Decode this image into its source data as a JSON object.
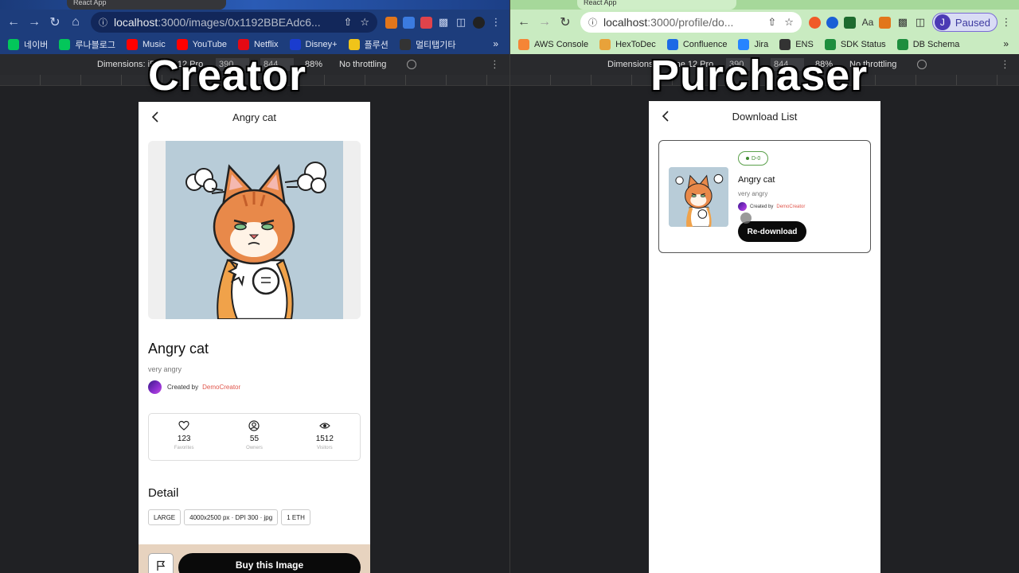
{
  "left": {
    "overlay_label": "Creator",
    "browser": {
      "tab_title": "React App",
      "url_host": "localhost",
      "url_path": ":3000/images/0x1192BBEAdc6...",
      "bookmarks": [
        "네이버",
        "루나블로그",
        "Music",
        "YouTube",
        "Netflix",
        "Disney+",
        "플루션",
        "멀티탭기타"
      ],
      "bookmark_colors": [
        "#03c75a",
        "#03c75a",
        "#ff0000",
        "#ff0000",
        "#e50914",
        "#1a3ccf",
        "#f0c419",
        "#333333"
      ]
    },
    "devtools": {
      "dimensions_label": "Dimensions: iPhone 12 Pro",
      "width": "390",
      "height": "844",
      "zoom": "88%",
      "throttling": "No throttling"
    },
    "page": {
      "header_title": "Angry cat",
      "image_title": "Angry cat",
      "image_desc": "very angry",
      "created_by_label": "Created by",
      "creator_name": "DemoCreator",
      "stats": [
        {
          "icon": "heart-icon",
          "value": "123",
          "label": "Favorites"
        },
        {
          "icon": "user-circle-icon",
          "value": "55",
          "label": "Owners"
        },
        {
          "icon": "eye-icon",
          "value": "1512",
          "label": "Visitors"
        }
      ],
      "detail_heading": "Detail",
      "chips": [
        "LARGE",
        "4000x2500 px · DPI 300 · jpg",
        "1 ETH"
      ],
      "buy_label": "Buy this Image"
    }
  },
  "right": {
    "overlay_label": "Purchaser",
    "browser": {
      "tab_title": "React App",
      "url_host": "localhost",
      "url_path": ":3000/profile/do...",
      "bookmarks": [
        "AWS Console",
        "HexToDec",
        "Confluence",
        "Jira",
        "ENS",
        "SDK Status",
        "DB Schema"
      ],
      "bookmark_colors": [
        "#f58536",
        "#e8a23a",
        "#1d6ae5",
        "#2684ff",
        "#333333",
        "#1e8e3e",
        "#1e8e3e"
      ],
      "profile_initial": "J",
      "profile_status": "Paused"
    },
    "devtools": {
      "dimensions_label": "Dimensions: iPhone 12 Pro",
      "width": "390",
      "height": "844",
      "zoom": "88%",
      "throttling": "No throttling"
    },
    "page": {
      "header_title": "Download List",
      "item": {
        "badge": "D-0",
        "title": "Angry cat",
        "desc": "very angry",
        "created_by_label": "Created by",
        "creator_name": "DemoCreator",
        "action_label": "Re-download"
      }
    }
  },
  "colors": {
    "accent_link": "#e0554b",
    "button_dark": "#0a0a0a",
    "badge_green": "#3e8a30"
  }
}
